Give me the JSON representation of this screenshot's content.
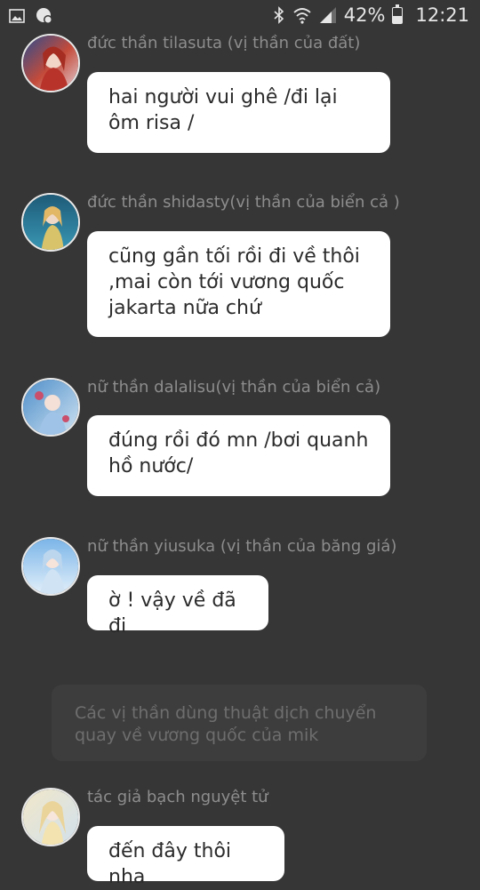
{
  "status_bar": {
    "left_icons": [
      "image-icon",
      "notification-settings-icon"
    ],
    "right_icons": [
      "bluetooth-icon",
      "wifi-icon",
      "signal-icon"
    ],
    "battery_percent_text": "42%",
    "battery_level": 0.42,
    "time": "12:21"
  },
  "messages": [
    {
      "sender": "đức thần tilasuta (vị thần của đất)",
      "text": "hai người vui ghê /đi lại ôm risa /"
    },
    {
      "sender": "đức thần shidasty(vị thần của biển cả )",
      "text": "cũng gần tối rồi đi về thôi ,mai còn tới vương quốc jakarta nữa chứ"
    },
    {
      "sender": "nữ thần dalalisu(vị thần của biển cả)",
      "text": "đúng rồi đó mn /bơi quanh hồ nước/"
    },
    {
      "sender": "nữ thần yiusuka (vị thần của băng giá)",
      "text": "ờ ! vậy về đã đi"
    }
  ],
  "narration": {
    "text": "Các vị thần dùng thuật dịch chuyển quay về vương quốc của mik"
  },
  "last_message": {
    "sender": "tác giả bạch nguyệt tử",
    "text": "đến đây thôi nha"
  },
  "colors": {
    "background": "#363636",
    "bubble": "#ffffff",
    "sender_text": "#8d8d8d",
    "narration_bg": "#3d3d3d"
  }
}
